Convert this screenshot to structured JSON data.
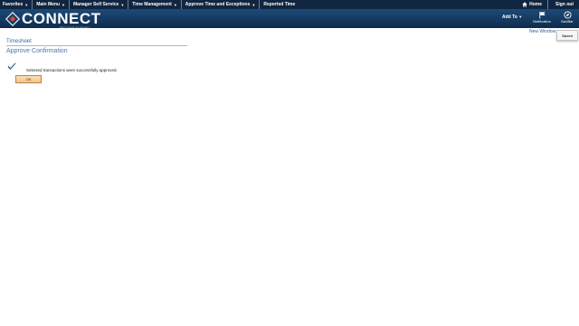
{
  "topnav": {
    "items": [
      {
        "label": "Favorites"
      },
      {
        "label": "Main Menu"
      },
      {
        "label": "Manager Self Service"
      },
      {
        "label": "Time Management"
      },
      {
        "label": "Approve Time and Exceptions"
      },
      {
        "label": "Reported Time"
      }
    ],
    "home_label": "Home",
    "signout_label": "Sign out"
  },
  "banner": {
    "logo_text": "CONNECT",
    "logo_subtext": "Maryland Judiciary",
    "add_to_label": "Add To",
    "notification_label": "Notification",
    "navbar_label": "NavBar",
    "new_window_label": "New Window",
    "saved_label": "Saved"
  },
  "main": {
    "breadcrumb": "Timesheet",
    "title": "Approve Confirmation",
    "message": "Selected transactions were successfully approved.",
    "ok_label": "OK"
  }
}
